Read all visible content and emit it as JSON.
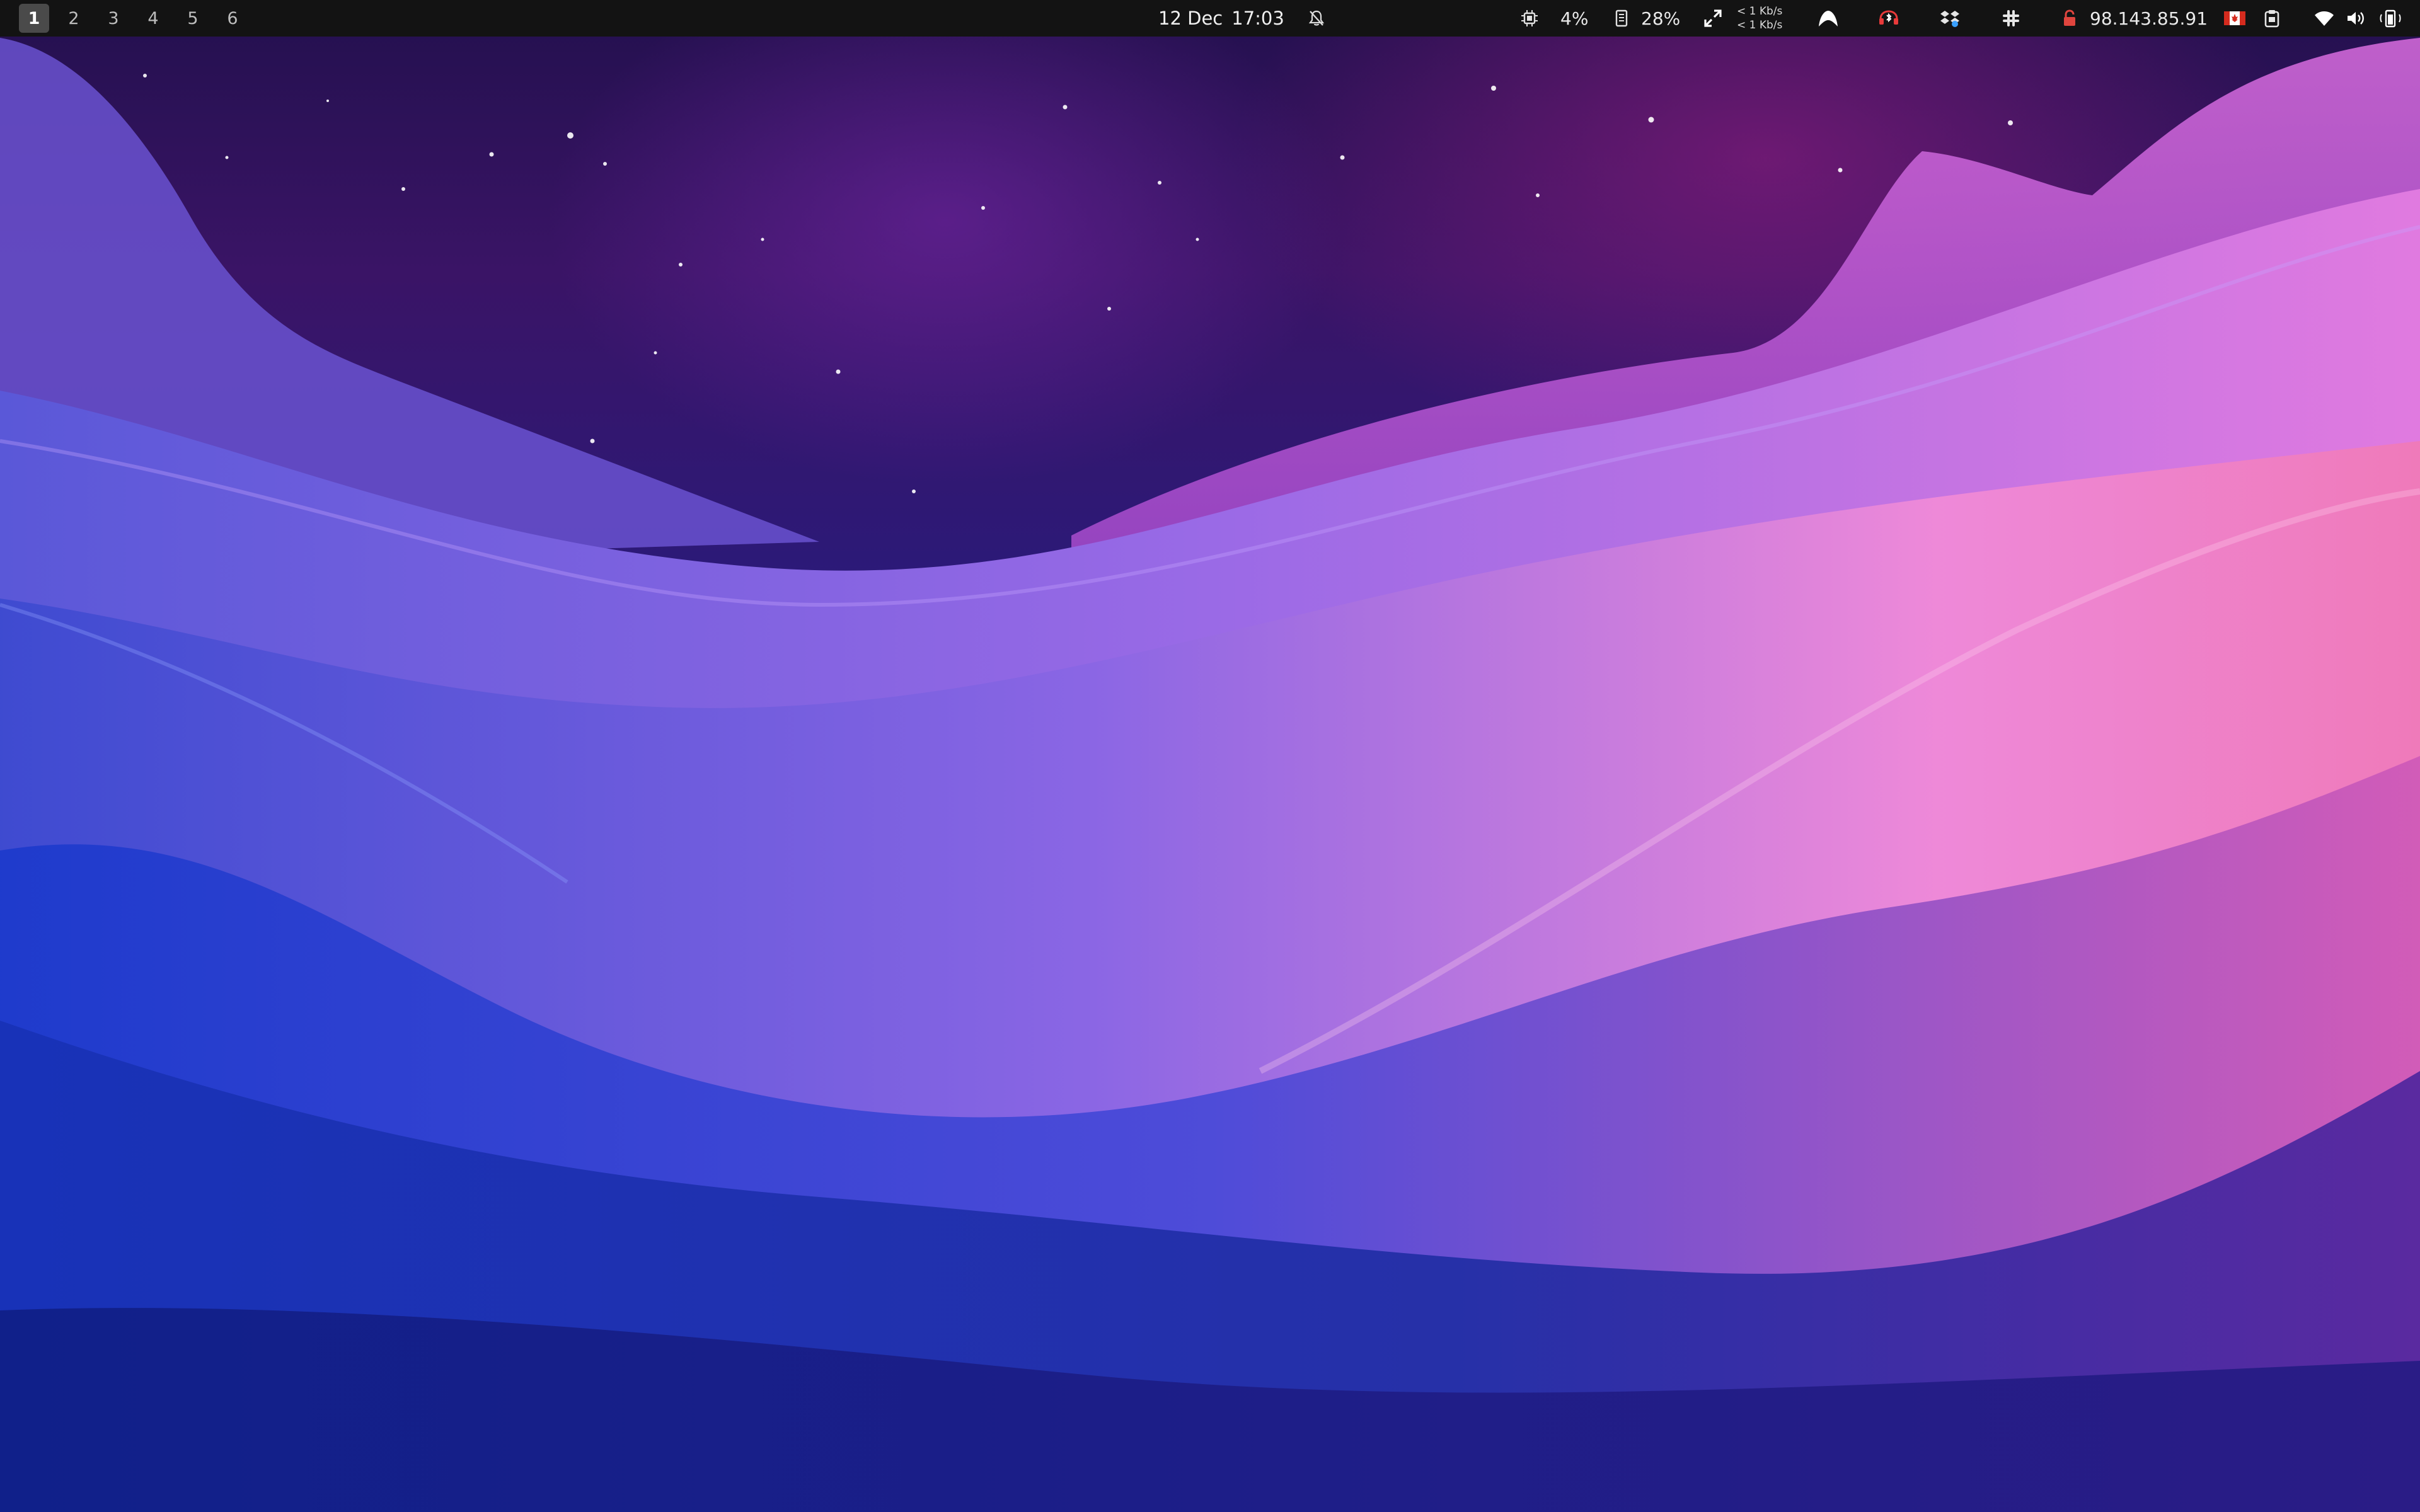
{
  "workspaces": [
    {
      "label": "1",
      "active": true
    },
    {
      "label": "2",
      "active": false
    },
    {
      "label": "3",
      "active": false
    },
    {
      "label": "4",
      "active": false
    },
    {
      "label": "5",
      "active": false
    },
    {
      "label": "6",
      "active": false
    }
  ],
  "clock": {
    "date": "12 Dec",
    "time": "17:03",
    "notifications_icon": "bell-slash-icon"
  },
  "tray": {
    "cpu": {
      "icon": "cpu-icon",
      "value": "4%"
    },
    "memory": {
      "icon": "memory-icon",
      "value": "28%"
    },
    "network_speed": {
      "icon": "expand-arrows-icon",
      "up": "< 1 Kb/s",
      "down": "< 1 Kb/s"
    },
    "icons": [
      "vpn-arch-icon",
      "bluetooth-headset-icon",
      "dropbox-icon",
      "slack-icon",
      "padlock-icon"
    ],
    "ip_address": "98.143.85.91",
    "country_flag": "canada-flag-icon",
    "clipboard_icon": "clipboard-icon",
    "wifi_icon": "wifi-icon",
    "volume_icon": "volume-icon",
    "battery_icon": "battery-icon"
  },
  "colors": {
    "bar_background": "#131313",
    "active_workspace": "#4a4a4a",
    "lock_red": "#e0453e",
    "flag_red": "#d52b1e"
  }
}
